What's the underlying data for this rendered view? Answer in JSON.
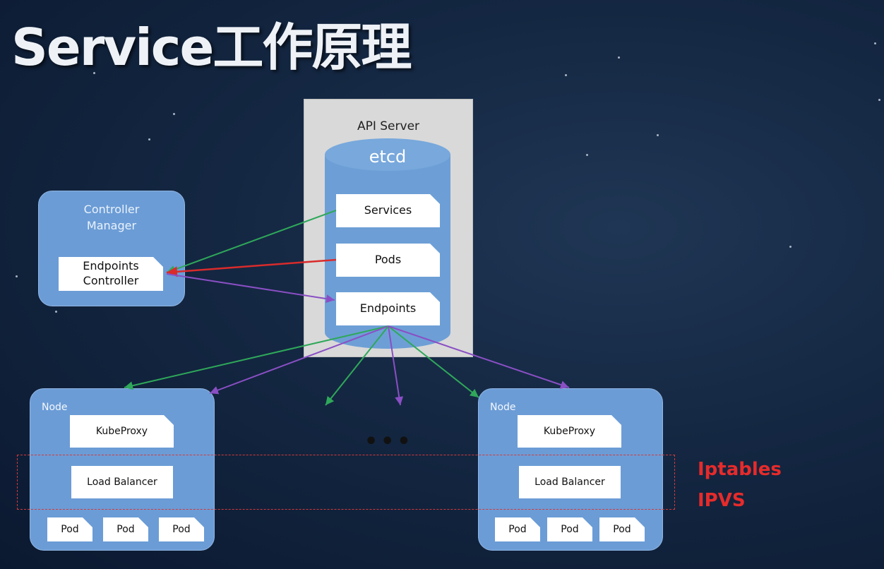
{
  "title": "Service工作原理",
  "api_server": {
    "label": "API Server",
    "etcd": {
      "label": "etcd",
      "items": [
        "Services",
        "Pods",
        "Endpoints"
      ]
    }
  },
  "controller_manager": {
    "label_line1": "Controller",
    "label_line2": "Manager",
    "endpoints_controller_line1": "Endpoints",
    "endpoints_controller_line2": "Controller"
  },
  "nodes": [
    {
      "label": "Node",
      "kubeproxy": "KubeProxy",
      "load_balancer": "Load Balancer",
      "pods": [
        "Pod",
        "Pod",
        "Pod"
      ]
    },
    {
      "label": "Node",
      "kubeproxy": "KubeProxy",
      "load_balancer": "Load Balancer",
      "pods": [
        "Pod",
        "Pod",
        "Pod"
      ]
    }
  ],
  "ellipsis": "•••",
  "proxy_modes": [
    "Iptables",
    "IPVS"
  ],
  "colors": {
    "panel": "#6b9cd6",
    "etcd": "#6d9fd6",
    "arrow_green": "#2fa85a",
    "arrow_red": "#d92b2b",
    "arrow_purple": "#8a4fc4",
    "highlight": "#e62b2b"
  }
}
